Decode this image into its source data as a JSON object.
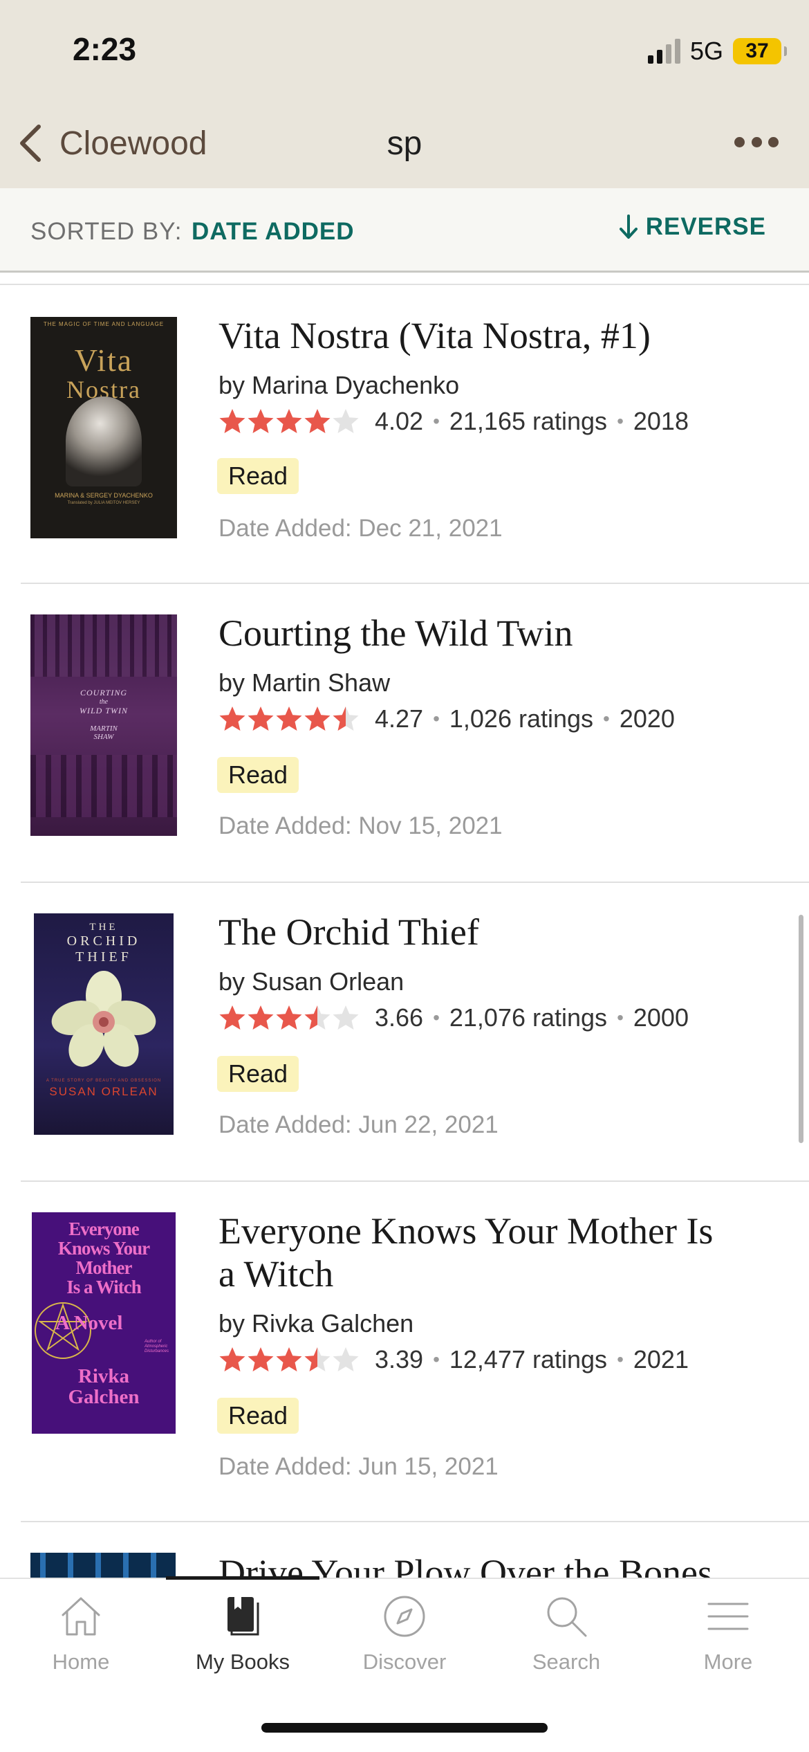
{
  "status_bar": {
    "time": "2:23",
    "network": "5G",
    "battery": "37",
    "battery_color": "#f4c400"
  },
  "nav": {
    "back_label": "Cloewood",
    "title": "sp",
    "back_icon": "chevron-left-icon",
    "more_icon": "ellipsis-icon"
  },
  "sort": {
    "label": "SORTED BY:",
    "value": "DATE ADDED",
    "reverse_label": "REVERSE",
    "accent": "#0e6a61"
  },
  "books": [
    {
      "title_lines": [
        "Vita Nostra (Vita Nostra, #1)"
      ],
      "author": "by Marina Dyachenko",
      "avg_rating": "4.02",
      "ratings_count": "21,165 ratings",
      "year": "2018",
      "shelf": "Read",
      "date_added": "Date Added: Dec 21, 2021",
      "stars_filled": 4.0,
      "cover": {
        "top_line": "THE MAGIC OF TIME AND LANGUAGE",
        "title_line_1": "Vita",
        "title_line_2": "Nostra",
        "credit_1": "MARINA & SERGEY DYACHENKO",
        "credit_2": "Translated by JULIA MEITOV HERSEY",
        "bg": "#1c1a17",
        "fg": "#c9a35a"
      }
    },
    {
      "title_lines": [
        "Courting the Wild Twin"
      ],
      "author": "by Martin Shaw",
      "avg_rating": "4.27",
      "ratings_count": "1,026 ratings",
      "year": "2020",
      "shelf": "Read",
      "date_added": "Date Added: Nov 15, 2021",
      "stars_filled": 4.5,
      "cover": {
        "line_1": "COURTING",
        "line_2": "the",
        "line_3": "WILD TWIN",
        "line_4": "MARTIN",
        "line_5": "SHAW",
        "bg": "#4a2350",
        "fg": "#e6cfe8"
      }
    },
    {
      "title_lines": [
        "The Orchid Thief"
      ],
      "author": "by Susan Orlean",
      "avg_rating": "3.66",
      "ratings_count": "21,076 ratings",
      "year": "2000",
      "shelf": "Read",
      "date_added": "Date Added: Jun 22, 2021",
      "stars_filled": 3.5,
      "cover": {
        "line_1": "THE",
        "line_2": "ORCHID",
        "line_3": "THIEF",
        "tagline": "A TRUE STORY OF BEAUTY AND OBSESSION",
        "author": "SUSAN ORLEAN",
        "bg": "#221b45",
        "fg": "#e8e3d4",
        "author_color": "#d9452f"
      }
    },
    {
      "title_lines": [
        "Everyone Knows Your Mother Is",
        "a Witch"
      ],
      "author": "by Rivka Galchen",
      "avg_rating": "3.39",
      "ratings_count": "12,477 ratings",
      "year": "2021",
      "shelf": "Read",
      "date_added": "Date Added: Jun 15, 2021",
      "stars_filled": 3.5,
      "cover": {
        "line_1": "Everyone",
        "line_2": "Knows Your",
        "line_3": "Mother",
        "line_4": "Is a Witch",
        "line_5": "A Novel",
        "line_6": "Rivka",
        "line_7": "Galchen",
        "side_1": "Author of",
        "side_2": "Atmospheric",
        "side_3": "Disturbances",
        "bg": "#47107a",
        "fg": "#ee6fc8"
      }
    },
    {
      "title_lines": [
        "Drive Your Plow Over the Bones"
      ],
      "cover": {
        "bg": "#0b2c4d"
      }
    }
  ],
  "star_color": "#e8574b",
  "star_empty_color": "#e3e3e3",
  "tabs": [
    {
      "label": "Home",
      "icon": "home-icon",
      "active": false
    },
    {
      "label": "My Books",
      "icon": "my-books-icon",
      "active": true
    },
    {
      "label": "Discover",
      "icon": "compass-icon",
      "active": false
    },
    {
      "label": "Search",
      "icon": "search-icon",
      "active": false
    },
    {
      "label": "More",
      "icon": "menu-icon",
      "active": false
    }
  ]
}
